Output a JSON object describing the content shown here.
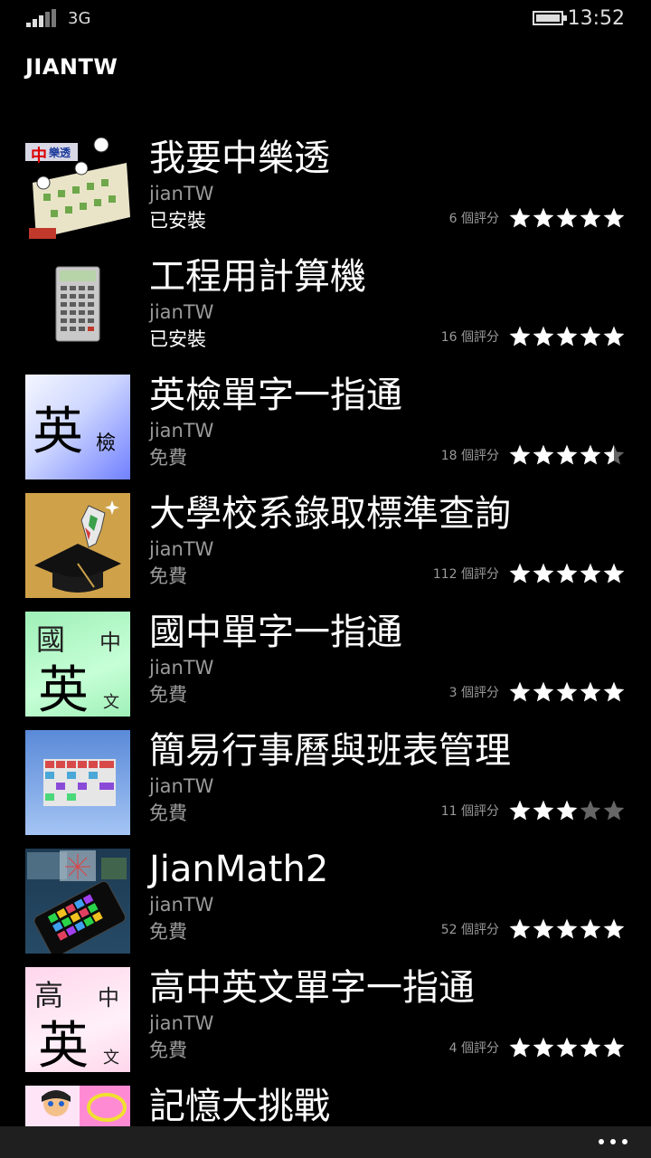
{
  "status": {
    "network": "3G",
    "time": "13:52"
  },
  "header": {
    "title": "JIANTW"
  },
  "apps": [
    {
      "name": "我要中樂透",
      "publisher": "jianTW",
      "state": "已安裝",
      "state_type": "installed",
      "rating_count": "6 個評分",
      "rating": 5,
      "icon": "lottery-app-icon"
    },
    {
      "name": "工程用計算機",
      "publisher": "jianTW",
      "state": "已安裝",
      "state_type": "installed",
      "rating_count": "16 個評分",
      "rating": 5,
      "icon": "calculator-app-icon"
    },
    {
      "name": "英檢單字一指通",
      "publisher": "jianTW",
      "state": "免費",
      "state_type": "free",
      "rating_count": "18 個評分",
      "rating": 4.5,
      "icon": "english-vocab-app-icon"
    },
    {
      "name": "大學校系錄取標準查詢",
      "publisher": "jianTW",
      "state": "免費",
      "state_type": "free",
      "rating_count": "112 個評分",
      "rating": 5,
      "icon": "graduation-cap-app-icon"
    },
    {
      "name": "國中單字一指通",
      "publisher": "jianTW",
      "state": "免費",
      "state_type": "free",
      "rating_count": "3 個評分",
      "rating": 5,
      "icon": "junior-english-app-icon"
    },
    {
      "name": "簡易行事曆與班表管理",
      "publisher": "jianTW",
      "state": "免費",
      "state_type": "free",
      "rating_count": "11 個評分",
      "rating": 3,
      "icon": "calendar-app-icon"
    },
    {
      "name": "JianMath2",
      "publisher": "jianTW",
      "state": "免費",
      "state_type": "free",
      "rating_count": "52 個評分",
      "rating": 5,
      "icon": "math-phone-app-icon"
    },
    {
      "name": "高中英文單字一指通",
      "publisher": "jianTW",
      "state": "免費",
      "state_type": "free",
      "rating_count": "4 個評分",
      "rating": 5,
      "icon": "senior-english-app-icon"
    },
    {
      "name": "記憶大挑戰",
      "publisher": "",
      "state": "",
      "state_type": "free",
      "rating_count": "",
      "rating": null,
      "icon": "memory-game-app-icon"
    }
  ],
  "thumb_text": {
    "english": [
      "英",
      "檢"
    ],
    "junior": [
      "國",
      "英",
      "中",
      "文"
    ],
    "senior": [
      "高",
      "英",
      "中",
      "文"
    ],
    "lottery": [
      "中",
      "樂透"
    ]
  },
  "app_bar": {
    "more_icon": "ellipsis-icon"
  }
}
